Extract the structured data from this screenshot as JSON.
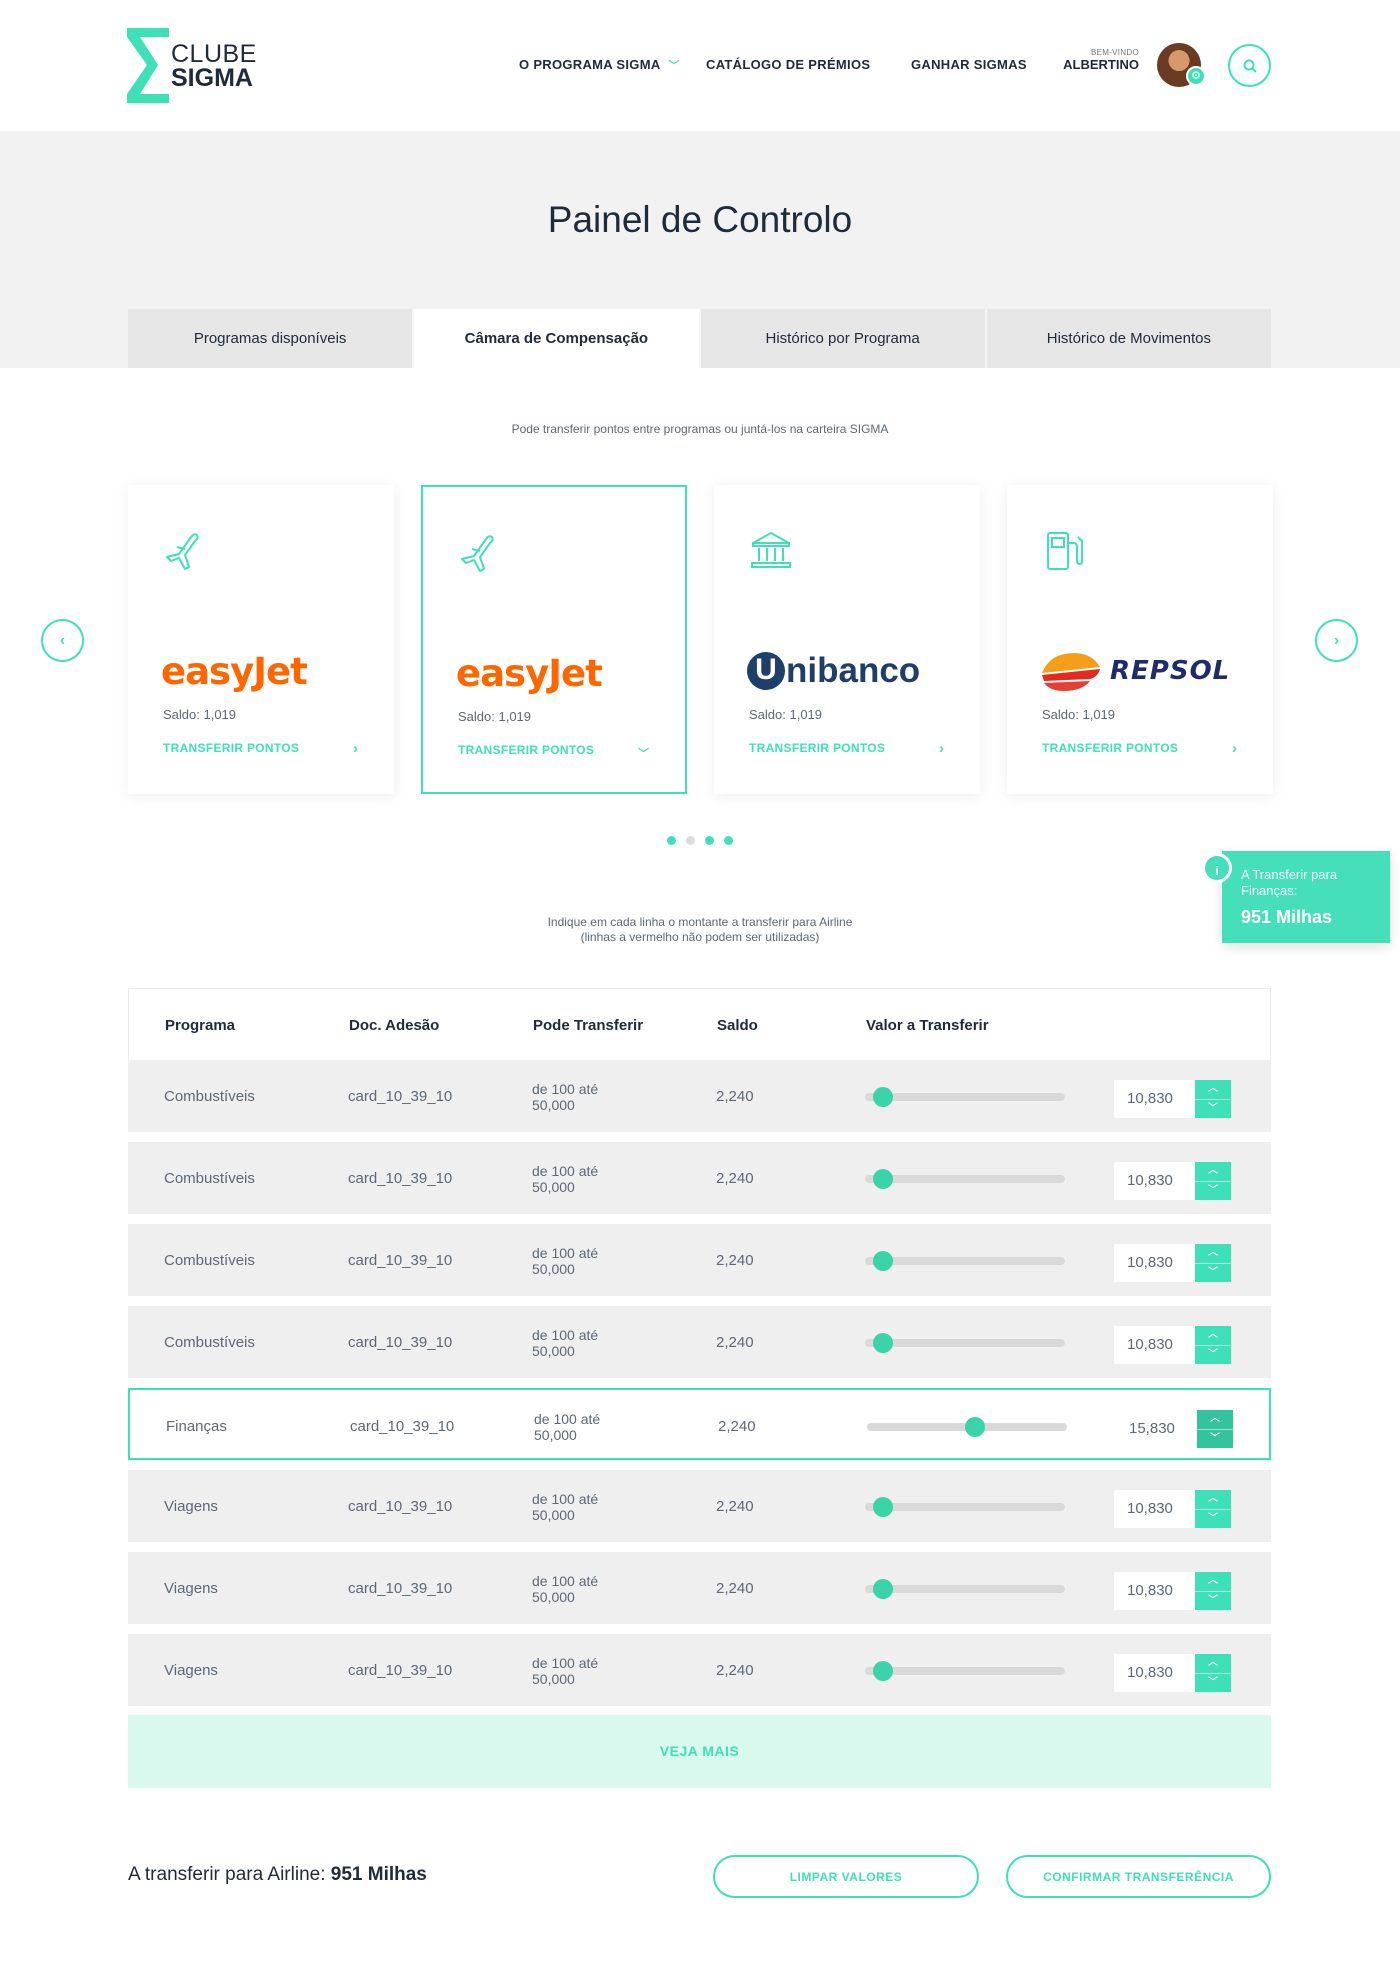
{
  "brand": {
    "line1": "CLUBE",
    "line2": "SIGMA"
  },
  "nav": {
    "items": [
      {
        "label": "O PROGRAMA SIGMA",
        "has_dropdown": true
      },
      {
        "label": "CATÁLOGO DE PRÉMIOS"
      },
      {
        "label": "GANHAR SIGMAS"
      }
    ],
    "welcome_small": "BEM-VINDO",
    "user_name": "ALBERTINO",
    "icons": {
      "search": "search-icon",
      "settings": "gear-icon"
    }
  },
  "page": {
    "title": "Painel de Controlo"
  },
  "tabs": [
    {
      "label": "Programas disponíveis",
      "active": false
    },
    {
      "label": "Câmara de Compensação",
      "active": true
    },
    {
      "label": "Histórico por Programa",
      "active": false
    },
    {
      "label": "Histórico de Movimentos",
      "active": false
    }
  ],
  "intro_text": "Pode transferir pontos entre programas ou juntá-los na carteira SIGMA",
  "cards": [
    {
      "icon": "plane-icon",
      "brand": "easyJet",
      "saldo": "Saldo: 1,019",
      "action": "TRANSFERIR PONTOS",
      "selected": false
    },
    {
      "icon": "plane-icon",
      "brand": "easyJet",
      "saldo": "Saldo: 1,019",
      "action": "TRANSFERIR PONTOS",
      "selected": true
    },
    {
      "icon": "bank-icon",
      "brand": "nibanco",
      "brand_initial": "U",
      "saldo": "Saldo: 1,019",
      "action": "TRANSFERIR PONTOS",
      "selected": false
    },
    {
      "icon": "fuel-pump-icon",
      "brand": "REPSOL",
      "saldo": "Saldo: 1,019",
      "action": "TRANSFERIR PONTOS",
      "selected": false
    }
  ],
  "carousel": {
    "pages": 4,
    "prev_icon": "chevron-left-icon",
    "next_icon": "chevron-right-icon"
  },
  "side_tip": {
    "info": "i",
    "label": "A Transferir para Finanças:",
    "value": "951 Milhas"
  },
  "instructions": {
    "line1": "Indique em cada linha o montante a transferir para Airline",
    "line2": "(linhas a vermelho não podem ser utilizadas)"
  },
  "table": {
    "headers": [
      "Programa",
      "Doc. Adesão",
      "Pode Transferir",
      "Saldo",
      "Valor a Transferir"
    ],
    "rows": [
      {
        "programa": "Combustíveis",
        "doc": "card_10_39_10",
        "pode": "de 100 até 50,000",
        "saldo": "2,240",
        "valor": "10,830",
        "slider": 0.05,
        "active": false
      },
      {
        "programa": "Combustíveis",
        "doc": "card_10_39_10",
        "pode": "de 100 até 50,000",
        "saldo": "2,240",
        "valor": "10,830",
        "slider": 0.05,
        "active": false
      },
      {
        "programa": "Combustíveis",
        "doc": "card_10_39_10",
        "pode": "de 100 até 50,000",
        "saldo": "2,240",
        "valor": "10,830",
        "slider": 0.05,
        "active": false
      },
      {
        "programa": "Combustíveis",
        "doc": "card_10_39_10",
        "pode": "de 100 até 50,000",
        "saldo": "2,240",
        "valor": "10,830",
        "slider": 0.05,
        "active": false
      },
      {
        "programa": "Finanças",
        "doc": "card_10_39_10",
        "pode": "de 100 até 50,000",
        "saldo": "2,240",
        "valor": "15,830",
        "slider": 0.5,
        "active": true
      },
      {
        "programa": "Viagens",
        "doc": "card_10_39_10",
        "pode": "de 100 até 50,000",
        "saldo": "2,240",
        "valor": "10,830",
        "slider": 0.05,
        "active": false
      },
      {
        "programa": "Viagens",
        "doc": "card_10_39_10",
        "pode": "de 100 até 50,000",
        "saldo": "2,240",
        "valor": "10,830",
        "slider": 0.05,
        "active": false
      },
      {
        "programa": "Viagens",
        "doc": "card_10_39_10",
        "pode": "de 100 até 50,000",
        "saldo": "2,240",
        "valor": "10,830",
        "slider": 0.05,
        "active": false
      }
    ],
    "more_label": "VEJA MAIS"
  },
  "footer": {
    "total_prefix": "A transferir para Airline:",
    "total_value": "951 Milhas",
    "clear_label": "LIMPAR VALORES",
    "confirm_label": "CONFIRMAR TRANSFERÊNCIA"
  },
  "colors": {
    "accent": "#3ee0b8",
    "easyjet": "#ff6600",
    "unibanco": "#1f3e6a",
    "repsol": "#1f2c6a"
  }
}
